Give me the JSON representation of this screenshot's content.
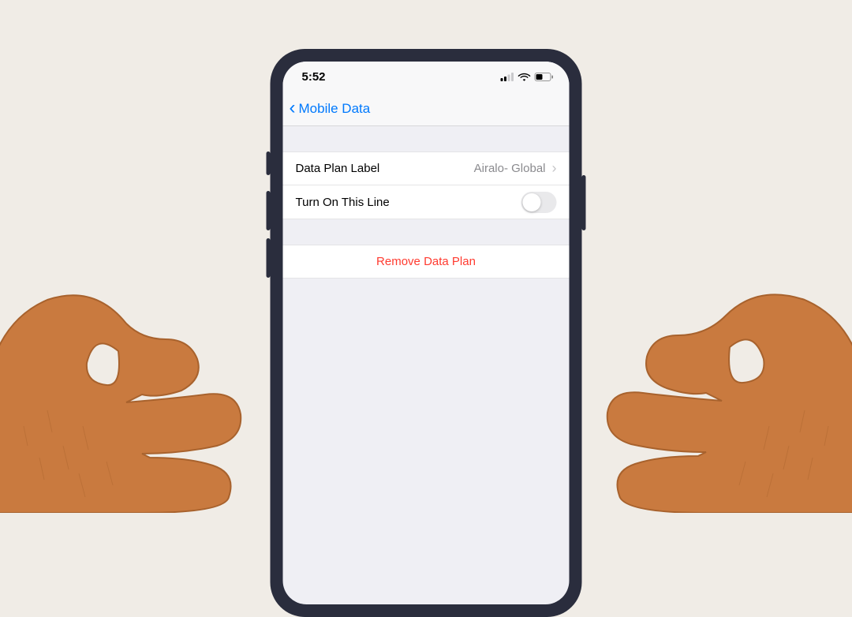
{
  "status": {
    "time": "5:52"
  },
  "nav": {
    "back_label": "Mobile Data"
  },
  "rows": {
    "data_plan_label": "Data Plan Label",
    "data_plan_value": "Airalo- Global",
    "turn_on_label": "Turn On This Line"
  },
  "actions": {
    "remove_label": "Remove Data Plan"
  }
}
